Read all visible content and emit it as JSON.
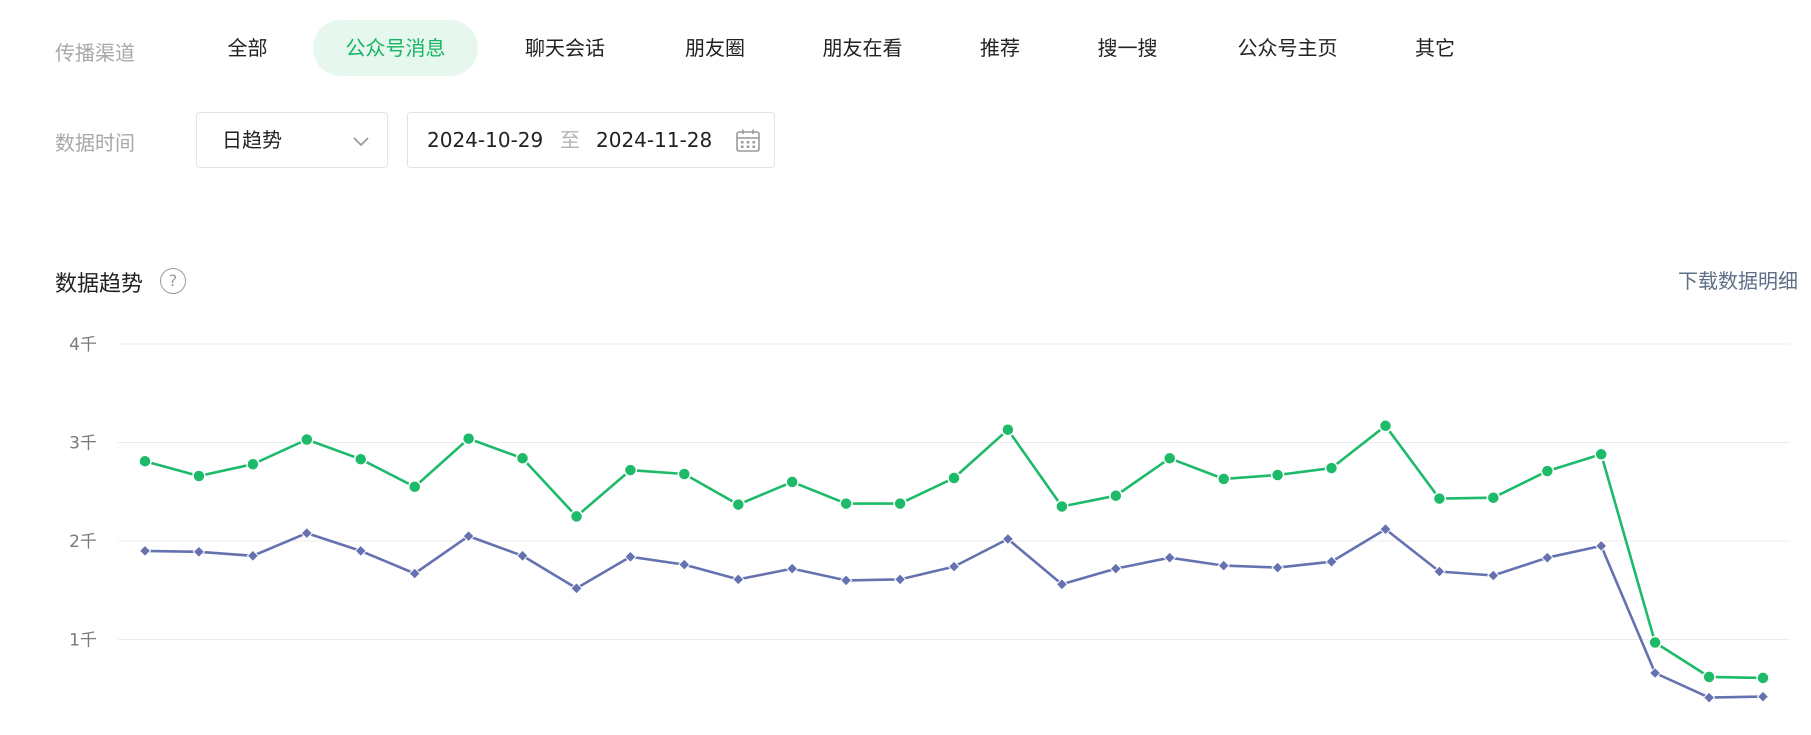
{
  "filters": {
    "channel_label": "传播渠道",
    "channels": [
      {
        "label": "全部",
        "active": false
      },
      {
        "label": "公众号消息",
        "active": true
      },
      {
        "label": "聊天会话",
        "active": false
      },
      {
        "label": "朋友圈",
        "active": false
      },
      {
        "label": "朋友在看",
        "active": false
      },
      {
        "label": "推荐",
        "active": false
      },
      {
        "label": "搜一搜",
        "active": false
      },
      {
        "label": "公众号主页",
        "active": false
      },
      {
        "label": "其它",
        "active": false
      }
    ],
    "time_label": "数据时间",
    "granularity": "日趋势",
    "date_start": "2024-10-29",
    "date_separator": "至",
    "date_end": "2024-11-28"
  },
  "section": {
    "title": "数据趋势",
    "help_glyph": "?",
    "download_label": "下载数据明细"
  },
  "colors": {
    "accent": "#16b464",
    "series_green": "#1dba6a",
    "series_blue": "#6672b0",
    "grid": "#ececec",
    "tick": "#7a7a7a"
  },
  "chart_data": {
    "type": "line",
    "yticks": [
      {
        "value": 1000,
        "label": "1千"
      },
      {
        "value": 2000,
        "label": "2千"
      },
      {
        "value": 3000,
        "label": "3千"
      },
      {
        "value": 4000,
        "label": "4千"
      }
    ],
    "series": [
      {
        "marker": "circle",
        "color": "#1dba6a",
        "values": [
          2810,
          2660,
          2780,
          3030,
          2830,
          2550,
          3040,
          2840,
          2250,
          2720,
          2680,
          2370,
          2600,
          2380,
          2380,
          2640,
          3130,
          2350,
          2460,
          2840,
          2630,
          2670,
          2740,
          3170,
          2430,
          2440,
          2710,
          2880,
          970,
          620,
          610
        ]
      },
      {
        "marker": "diamond",
        "color": "#6672b0",
        "values": [
          1900,
          1890,
          1850,
          2080,
          1900,
          1670,
          2050,
          1850,
          1520,
          1840,
          1760,
          1610,
          1720,
          1600,
          1610,
          1740,
          2020,
          1560,
          1720,
          1830,
          1750,
          1730,
          1790,
          2120,
          1690,
          1650,
          1830,
          1950,
          660,
          410,
          420
        ]
      }
    ]
  }
}
